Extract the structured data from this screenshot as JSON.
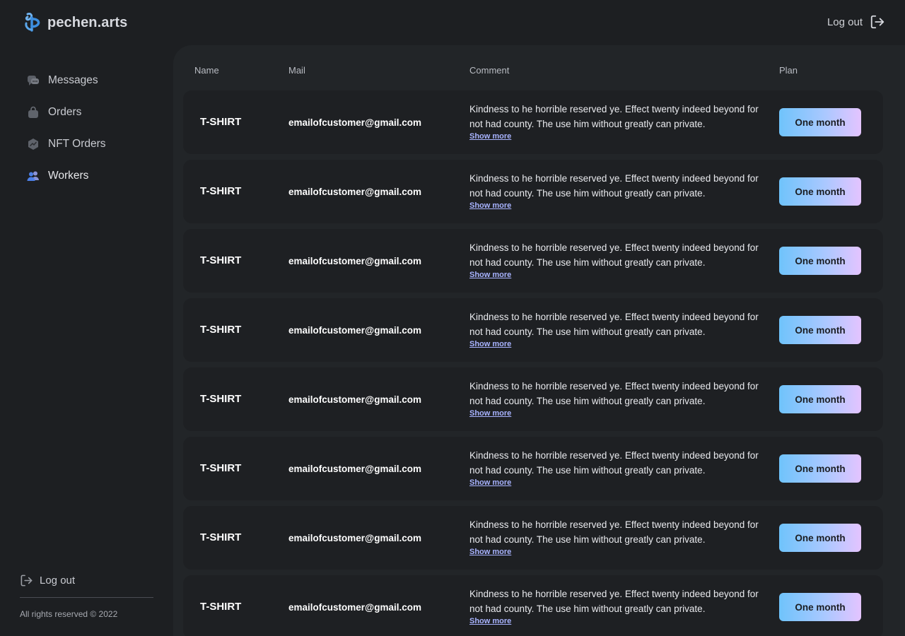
{
  "brand": {
    "name": "pechen.arts"
  },
  "header": {
    "logout_label": "Log out"
  },
  "sidebar": {
    "items": [
      {
        "label": "Messages",
        "icon": "chat-icon"
      },
      {
        "label": "Orders",
        "icon": "bag-icon"
      },
      {
        "label": "NFT Orders",
        "icon": "nft-icon"
      },
      {
        "label": "Workers",
        "icon": "users-icon",
        "active": true
      }
    ],
    "logout_label": "Log out",
    "copyright": "All rights reserved © 2022"
  },
  "table": {
    "columns": {
      "name": "Name",
      "mail": "Mail",
      "comment": "Comment",
      "plan": "Plan"
    },
    "rows": [
      {
        "name": "T-SHIRT",
        "mail": "emailofcustomer@gmail.com",
        "comment": "Kindness to he horrible reserved ye. Effect twenty indeed beyond for not had county. The use him without greatly can private.",
        "show_more": "Show more",
        "plan": "One month"
      },
      {
        "name": "T-SHIRT",
        "mail": "emailofcustomer@gmail.com",
        "comment": "Kindness to he horrible reserved ye. Effect twenty indeed beyond for not had county. The use him without greatly can private.",
        "show_more": "Show more",
        "plan": "One month"
      },
      {
        "name": "T-SHIRT",
        "mail": "emailofcustomer@gmail.com",
        "comment": "Kindness to he horrible reserved ye. Effect twenty indeed beyond for not had county. The use him without greatly can private.",
        "show_more": "Show more",
        "plan": "One month"
      },
      {
        "name": "T-SHIRT",
        "mail": "emailofcustomer@gmail.com",
        "comment": "Kindness to he horrible reserved ye. Effect twenty indeed beyond for not had county. The use him without greatly can private.",
        "show_more": "Show more",
        "plan": "One month"
      },
      {
        "name": "T-SHIRT",
        "mail": "emailofcustomer@gmail.com",
        "comment": "Kindness to he horrible reserved ye. Effect twenty indeed beyond for not had county. The use him without greatly can private.",
        "show_more": "Show more",
        "plan": "One month"
      },
      {
        "name": "T-SHIRT",
        "mail": "emailofcustomer@gmail.com",
        "comment": "Kindness to he horrible reserved ye. Effect twenty indeed beyond for not had county. The use him without greatly can private.",
        "show_more": "Show more",
        "plan": "One month"
      },
      {
        "name": "T-SHIRT",
        "mail": "emailofcustomer@gmail.com",
        "comment": "Kindness to he horrible reserved ye. Effect twenty indeed beyond for not had county. The use him without greatly can private.",
        "show_more": "Show more",
        "plan": "One month"
      },
      {
        "name": "T-SHIRT",
        "mail": "emailofcustomer@gmail.com",
        "comment": "Kindness to he horrible reserved ye. Effect twenty indeed beyond for not had county. The use him without greatly can private.",
        "show_more": "Show more",
        "plan": "One month"
      }
    ]
  },
  "colors": {
    "background": "#1d1f22",
    "panel": "#222528",
    "row": "#1e2023",
    "accent_link": "#a8b3ff",
    "plan_gradient_start": "#6fc3fb",
    "plan_gradient_end": "#e4c4ff",
    "logo_blue": "#3d8fe0"
  }
}
